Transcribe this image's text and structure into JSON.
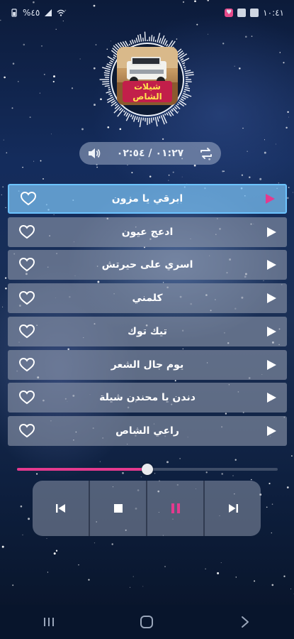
{
  "status_bar": {
    "time": "١٠:٤١",
    "battery": "%٤٥"
  },
  "album": {
    "title": "شيلات الشاص"
  },
  "player": {
    "time_display": "٠١:٢٧ / ٠٢:٥٤",
    "progress_fraction": 0.5
  },
  "tracks": [
    {
      "name": "ابرقي يا مزون",
      "active": true
    },
    {
      "name": "ادعج عيون",
      "active": false
    },
    {
      "name": "اسري على حيرتش",
      "active": false
    },
    {
      "name": "كلمني",
      "active": false
    },
    {
      "name": "تيك توك",
      "active": false
    },
    {
      "name": "يوم جال الشعر",
      "active": false
    },
    {
      "name": "دندن يا محندن شيلة",
      "active": false
    },
    {
      "name": "راعي الشاص",
      "active": false
    }
  ],
  "controls": [
    "previous-icon",
    "stop-icon",
    "pause-icon",
    "next-icon"
  ],
  "colors": {
    "accent": "#e43a8e",
    "active_row_border": "#6cc3ff"
  }
}
